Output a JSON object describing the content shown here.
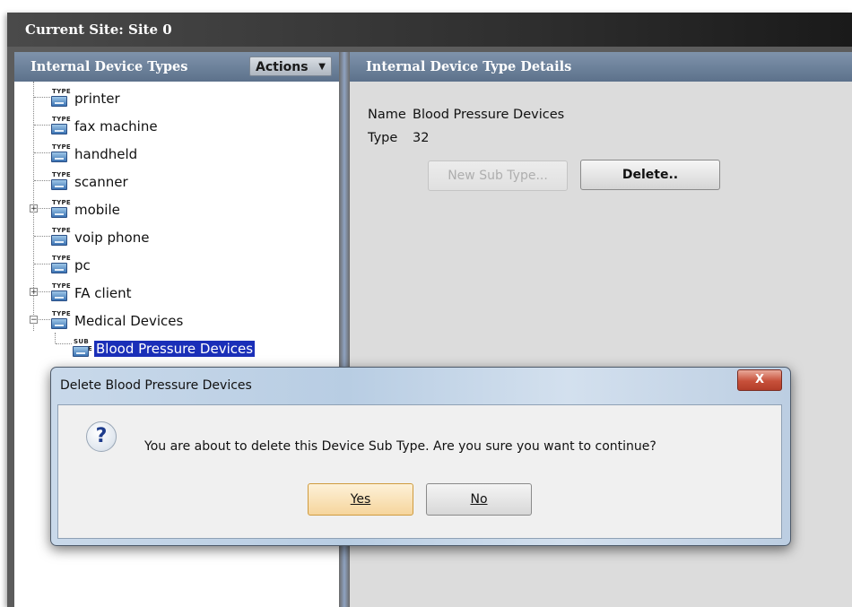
{
  "site_header": {
    "label": "Current Site:",
    "value": "Site 0"
  },
  "left_panel": {
    "title": "Internal Device Types",
    "actions_label": "Actions",
    "tree": [
      {
        "label": "printer",
        "icon_tag": "TYPE",
        "expander": ""
      },
      {
        "label": "fax machine",
        "icon_tag": "TYPE",
        "expander": ""
      },
      {
        "label": "handheld",
        "icon_tag": "TYPE",
        "expander": ""
      },
      {
        "label": "scanner",
        "icon_tag": "TYPE",
        "expander": ""
      },
      {
        "label": "mobile",
        "icon_tag": "TYPE",
        "expander": "+"
      },
      {
        "label": "voip phone",
        "icon_tag": "TYPE",
        "expander": ""
      },
      {
        "label": "pc",
        "icon_tag": "TYPE",
        "expander": ""
      },
      {
        "label": "FA client",
        "icon_tag": "TYPE",
        "expander": "+"
      },
      {
        "label": "Medical Devices",
        "icon_tag": "TYPE",
        "expander": "−"
      },
      {
        "label": "Blood Pressure Devices",
        "icon_tag": "SUB TYPE",
        "expander": "",
        "selected": true
      }
    ]
  },
  "right_panel": {
    "title": "Internal Device Type Details",
    "name_label": "Name",
    "name_value": "Blood Pressure Devices",
    "type_label": "Type",
    "type_value": "32",
    "new_sub_type_button": "New Sub Type...",
    "delete_button": "Delete.."
  },
  "dialog": {
    "title": "Delete Blood Pressure Devices",
    "close_glyph": "X",
    "message": "You are about to delete this Device Sub Type. Are you sure you want to continue?",
    "yes_label": "Yes",
    "no_label": "No"
  }
}
